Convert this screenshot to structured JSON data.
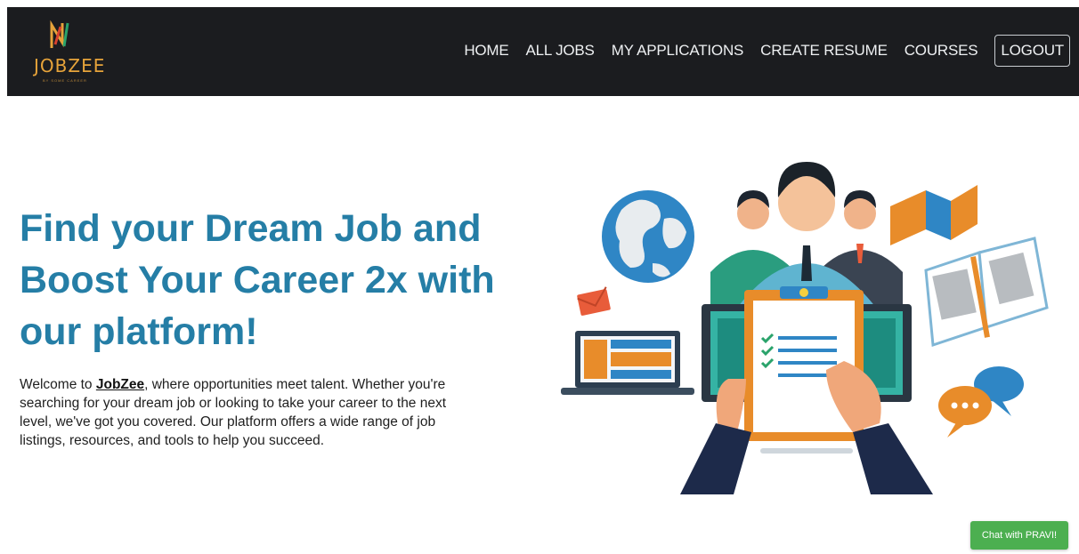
{
  "brand": {
    "logo_text": "JOBZEE",
    "logo_tagline": "BY SOME CAREER"
  },
  "nav": {
    "items": [
      {
        "label": "HOME"
      },
      {
        "label": "ALL JOBS"
      },
      {
        "label": "MY APPLICATIONS"
      },
      {
        "label": "CREATE RESUME"
      },
      {
        "label": "COURSES"
      }
    ],
    "logout_label": "LOGOUT"
  },
  "hero": {
    "title": "Find your Dream Job and Boost Your Career 2x with our platform!",
    "intro_prefix": "Welcome to ",
    "intro_brand": "JobZee",
    "intro_rest": ", where opportunities meet talent. Whether you're searching for your dream job or looking to take your career to the next level, we've got you covered. Our platform offers a wide range of job listings, resources, and tools to help you succeed."
  },
  "chat": {
    "label": "Chat with PRAVI!"
  },
  "colors": {
    "navbar_bg": "#1b1c1f",
    "title_blue": "#257ea6",
    "logo_gold": "#e6a33a",
    "chat_green": "#4caf50"
  }
}
